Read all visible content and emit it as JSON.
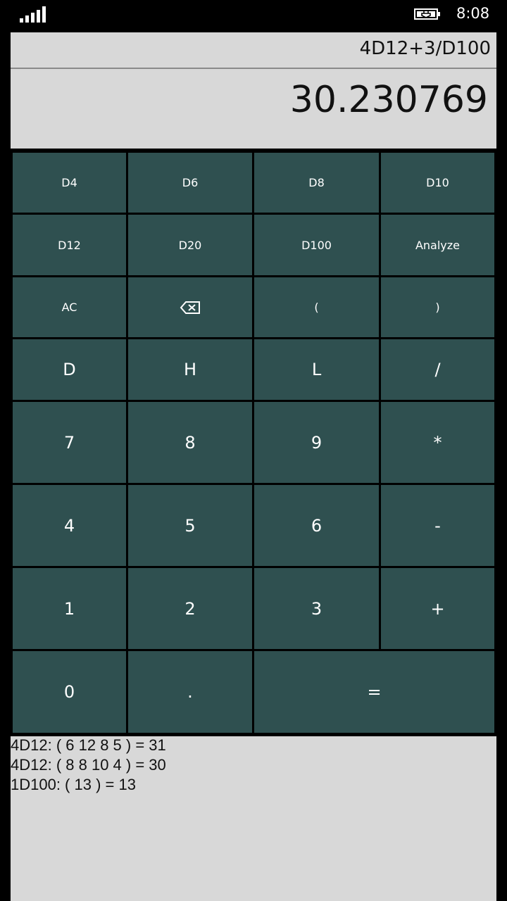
{
  "status_bar": {
    "time": "8:08",
    "signal_icon": "signal-bars-icon",
    "battery_icon": "battery-charging-icon"
  },
  "display": {
    "expression": "4D12+3/D100",
    "result": "30.230769"
  },
  "keys": {
    "d4": "D4",
    "d6": "D6",
    "d8": "D8",
    "d10": "D10",
    "d12": "D12",
    "d20": "D20",
    "d100": "D100",
    "analyze": "Analyze",
    "ac": "AC",
    "backspace_icon": "backspace-icon",
    "lparen": "(",
    "rparen": ")",
    "d": "D",
    "h": "H",
    "l": "L",
    "divide": "/",
    "seven": "7",
    "eight": "8",
    "nine": "9",
    "multiply": "*",
    "four": "4",
    "five": "5",
    "six": "6",
    "minus": "-",
    "one": "1",
    "two": "2",
    "three": "3",
    "plus": "+",
    "zero": "0",
    "dot": ".",
    "equals": "="
  },
  "history": [
    "4D12: ( 6 12 8 5 ) = 31",
    "4D12: ( 8 8 10 4 ) = 30",
    "1D100: ( 13 ) = 13"
  ],
  "colors": {
    "key_background": "#2f5050",
    "display_background": "#d8d8d8",
    "app_background": "#000000"
  }
}
